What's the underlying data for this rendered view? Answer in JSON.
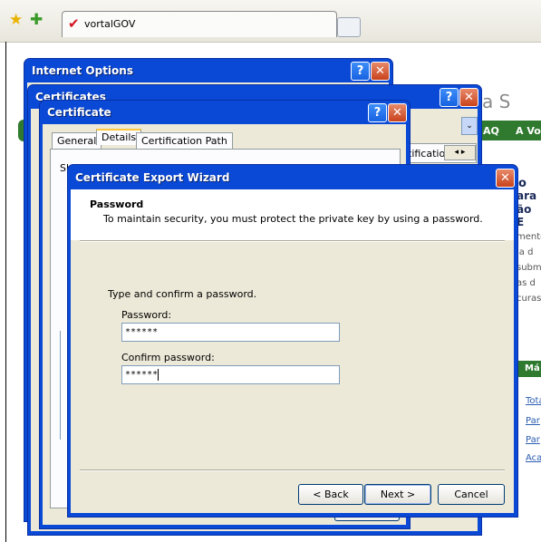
{
  "browser": {
    "tab_title": "vortalGOV"
  },
  "background_site": {
    "heading_fragment": "ça S",
    "nav_items": [
      "AQ",
      "A Vo"
    ],
    "bold_fragments": [
      "o",
      "ara",
      "ão E"
    ],
    "text_fragments": [
      "mente",
      "ia d",
      "subm",
      "as d",
      "curas"
    ],
    "section_label": "Má",
    "links": [
      "Tota",
      "Par",
      "Par",
      "Aca"
    ]
  },
  "internet_options": {
    "title": "Internet Options"
  },
  "certificates": {
    "title": "Certificates",
    "visible_tab": "tificatior"
  },
  "certificate": {
    "title": "Certificate",
    "tabs": [
      "General",
      "Details",
      "Certification Path"
    ],
    "active_tab": "Details",
    "show_label": "Sh"
  },
  "wizard": {
    "title": "Certificate Export Wizard",
    "header_title": "Password",
    "header_subtitle": "To maintain security, you must protect the private key by using a password.",
    "instruction": "Type and confirm a password.",
    "password_label": "Password:",
    "password_value": "******",
    "confirm_label": "Confirm password:",
    "confirm_value": "******",
    "buttons": {
      "back": "< Back",
      "next": "Next >",
      "cancel": "Cancel"
    }
  }
}
